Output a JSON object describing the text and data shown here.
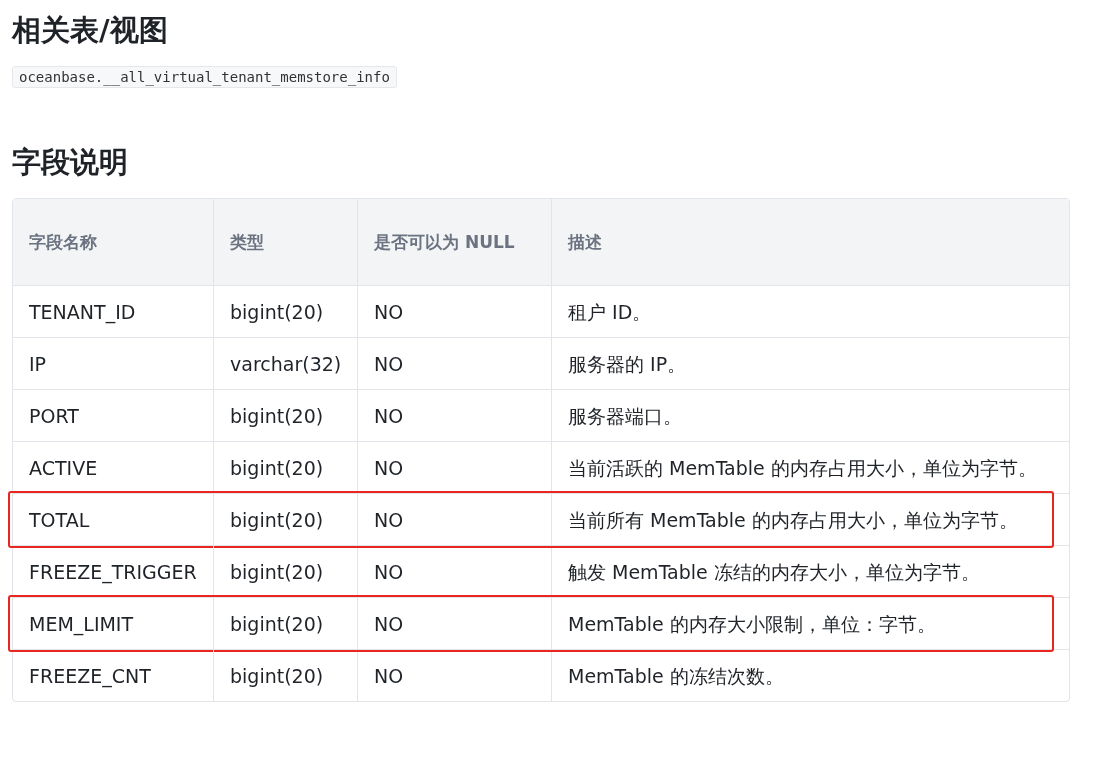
{
  "sections": [
    {
      "heading": "相关表/视图",
      "code": "oceanbase.__all_virtual_tenant_memstore_info"
    },
    {
      "heading": "字段说明"
    }
  ],
  "table": {
    "columns": [
      "字段名称",
      "类型",
      "是否可以为 NULL",
      "描述"
    ],
    "rows": [
      {
        "cells": [
          "TENANT_ID",
          "bigint(20)",
          "NO",
          "租户 ID。"
        ],
        "highlighted": false
      },
      {
        "cells": [
          "IP",
          "varchar(32)",
          "NO",
          "服务器的 IP。"
        ],
        "highlighted": false
      },
      {
        "cells": [
          "PORT",
          "bigint(20)",
          "NO",
          "服务器端口。"
        ],
        "highlighted": false
      },
      {
        "cells": [
          "ACTIVE",
          "bigint(20)",
          "NO",
          "当前活跃的 MemTable 的内存占用大小，单位为字节。"
        ],
        "highlighted": false
      },
      {
        "cells": [
          "TOTAL",
          "bigint(20)",
          "NO",
          "当前所有 MemTable 的内存占用大小，单位为字节。"
        ],
        "highlighted": true
      },
      {
        "cells": [
          "FREEZE_TRIGGER",
          "bigint(20)",
          "NO",
          "触发 MemTable 冻结的内存大小，单位为字节。"
        ],
        "highlighted": false
      },
      {
        "cells": [
          "MEM_LIMIT",
          "bigint(20)",
          "NO",
          "MemTable 的内存大小限制，单位：字节。"
        ],
        "highlighted": true
      },
      {
        "cells": [
          "FREEZE_CNT",
          "bigint(20)",
          "NO",
          "MemTable 的冻结次数。"
        ],
        "highlighted": false
      }
    ]
  }
}
